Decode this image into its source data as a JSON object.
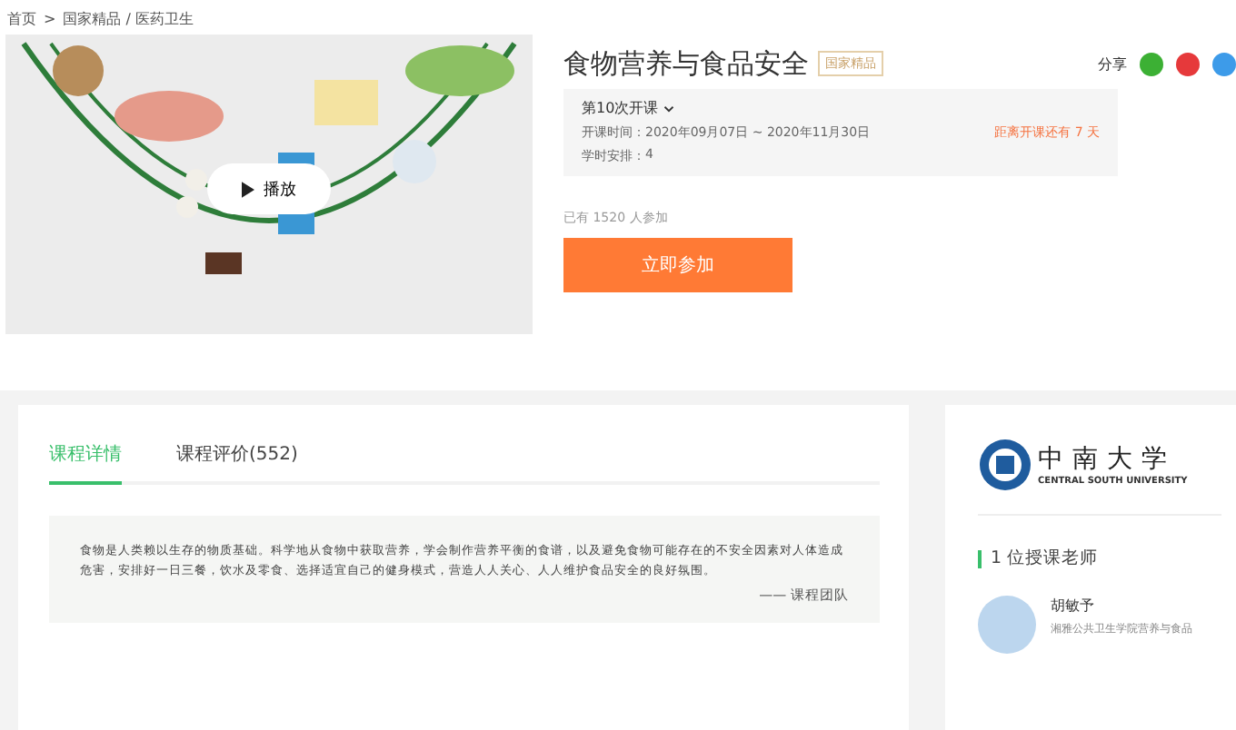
{
  "breadcrumb": [
    "首页",
    ">",
    "国家精品 / 医药卫生"
  ],
  "video": {
    "play_label": "播放"
  },
  "course": {
    "title": "食物营养与食品安全",
    "badge": "国家精品",
    "share_label": "分享",
    "session": "第10次开课",
    "time_label": "开课时间：",
    "time_value": "2020年09月07日 ~ 2020年11月30日",
    "countdown": "距离开课还有 7 天",
    "hours_label": "学时安排：",
    "hours_value": "4",
    "participants": "已有 1520 人参加",
    "join_button": "立即参加"
  },
  "tabs": [
    {
      "label": "课程详情",
      "selected": true
    },
    {
      "label": "课程评价(552)",
      "selected": false
    }
  ],
  "description": {
    "text": "食物是人类赖以生存的物质基础。科学地从食物中获取营养，学会制作营养平衡的食谱，以及避免食物可能存在的不安全因素对人体造成危害，安排好一日三餐，饮水及零食、选择适宜自己的健身模式，营造人人关心、人人维护食品安全的良好氛围。",
    "signature": "—— 课程团队"
  },
  "university": {
    "name_cn": "中南大学",
    "name_en": "CENTRAL SOUTH UNIVERSITY"
  },
  "teachers": {
    "heading": "1 位授课老师",
    "items": [
      {
        "name": "胡敏予",
        "title": "湘雅公共卫生学院营养与食品"
      }
    ]
  }
}
